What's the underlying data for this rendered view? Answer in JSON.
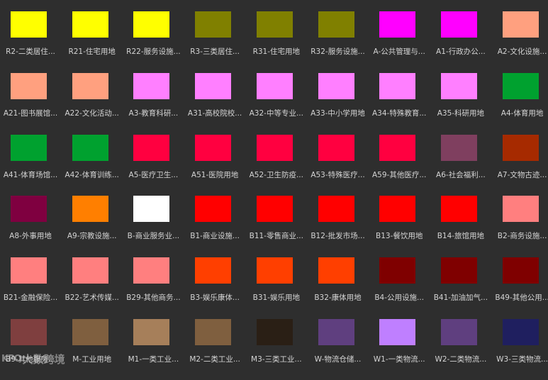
{
  "cells": [
    {
      "label": "R2-二类居住...",
      "color": "#ffff00"
    },
    {
      "label": "R21-住宅用地",
      "color": "#ffff00"
    },
    {
      "label": "R22-服务设施...",
      "color": "#ffff00"
    },
    {
      "label": "R3-三类居住...",
      "color": "#808000"
    },
    {
      "label": "R31-住宅用地",
      "color": "#808000"
    },
    {
      "label": "R32-服务设施...",
      "color": "#808000"
    },
    {
      "label": "A-公共管理与...",
      "color": "#ff00ff"
    },
    {
      "label": "A1-行政办公...",
      "color": "#ff00ff"
    },
    {
      "label": "A2-文化设施...",
      "color": "#ffa07f"
    },
    {
      "label": "A21-图书展馆...",
      "color": "#ffa07f"
    },
    {
      "label": "A22-文化活动...",
      "color": "#ffa07f"
    },
    {
      "label": "A3-教育科研...",
      "color": "#ff7fff"
    },
    {
      "label": "A31-高校院校...",
      "color": "#ff7fff"
    },
    {
      "label": "A32-中等专业...",
      "color": "#ff7fff"
    },
    {
      "label": "A33-中小学用地",
      "color": "#ff7fff"
    },
    {
      "label": "A34-特殊教育...",
      "color": "#ff7fff"
    },
    {
      "label": "A35-科研用地",
      "color": "#ff7fff"
    },
    {
      "label": "A4-体育用地",
      "color": "#00a12f"
    },
    {
      "label": "A41-体育场馆...",
      "color": "#00a12f"
    },
    {
      "label": "A42-体育训练...",
      "color": "#00a12f"
    },
    {
      "label": "A5-医疗卫生...",
      "color": "#ff0040"
    },
    {
      "label": "A51-医院用地",
      "color": "#ff0040"
    },
    {
      "label": "A52-卫生防疫...",
      "color": "#ff0040"
    },
    {
      "label": "A53-特殊医疗...",
      "color": "#ff0040"
    },
    {
      "label": "A59-其他医疗...",
      "color": "#ff0040"
    },
    {
      "label": "A6-社会福利...",
      "color": "#7f3f5f"
    },
    {
      "label": "A7-文物古迹...",
      "color": "#a62a00"
    },
    {
      "label": "A8-外事用地",
      "color": "#7f0040"
    },
    {
      "label": "A9-宗教设施...",
      "color": "#ff7f00"
    },
    {
      "label": "B-商业服务业...",
      "color": "#ffffff"
    },
    {
      "label": "B1-商业设施...",
      "color": "#ff0000"
    },
    {
      "label": "B11-零售商业...",
      "color": "#ff0000"
    },
    {
      "label": "B12-批发市场...",
      "color": "#ff0000"
    },
    {
      "label": "B13-餐饮用地",
      "color": "#ff0000"
    },
    {
      "label": "B14-旅馆用地",
      "color": "#ff0000"
    },
    {
      "label": "B2-商务设施...",
      "color": "#ff7f7f"
    },
    {
      "label": "B21-金融保险...",
      "color": "#ff7f7f"
    },
    {
      "label": "B22-艺术传媒...",
      "color": "#ff7f7f"
    },
    {
      "label": "B29-其他商务...",
      "color": "#ff7f7f"
    },
    {
      "label": "B3-娱乐康体...",
      "color": "#ff3f00"
    },
    {
      "label": "B31-娱乐用地",
      "color": "#ff3f00"
    },
    {
      "label": "B32-康体用地",
      "color": "#ff3f00"
    },
    {
      "label": "B4-公用设施...",
      "color": "#7f0000"
    },
    {
      "label": "B41-加油加气...",
      "color": "#7f0000"
    },
    {
      "label": "B49-其他公用...",
      "color": "#7f0000"
    },
    {
      "label": "B9-其他服务...",
      "color": "#7f3f3f"
    },
    {
      "label": "M-工业用地",
      "color": "#7f5f3f"
    },
    {
      "label": "M1-一类工业...",
      "color": "#a67f5a"
    },
    {
      "label": "M2-二类工业...",
      "color": "#7f5f3f"
    },
    {
      "label": "M3-三类工业...",
      "color": "#2a1f15"
    },
    {
      "label": "W-物流仓储...",
      "color": "#5f3f7f"
    },
    {
      "label": "W1-一类物流...",
      "color": "#bf7fff"
    },
    {
      "label": "W2-二类物流...",
      "color": "#5f3f7f"
    },
    {
      "label": "W3-三类物流...",
      "color": "#1f1f5f"
    }
  ],
  "watermark": {
    "logo": "KPO",
    "text": "大数跨境"
  }
}
